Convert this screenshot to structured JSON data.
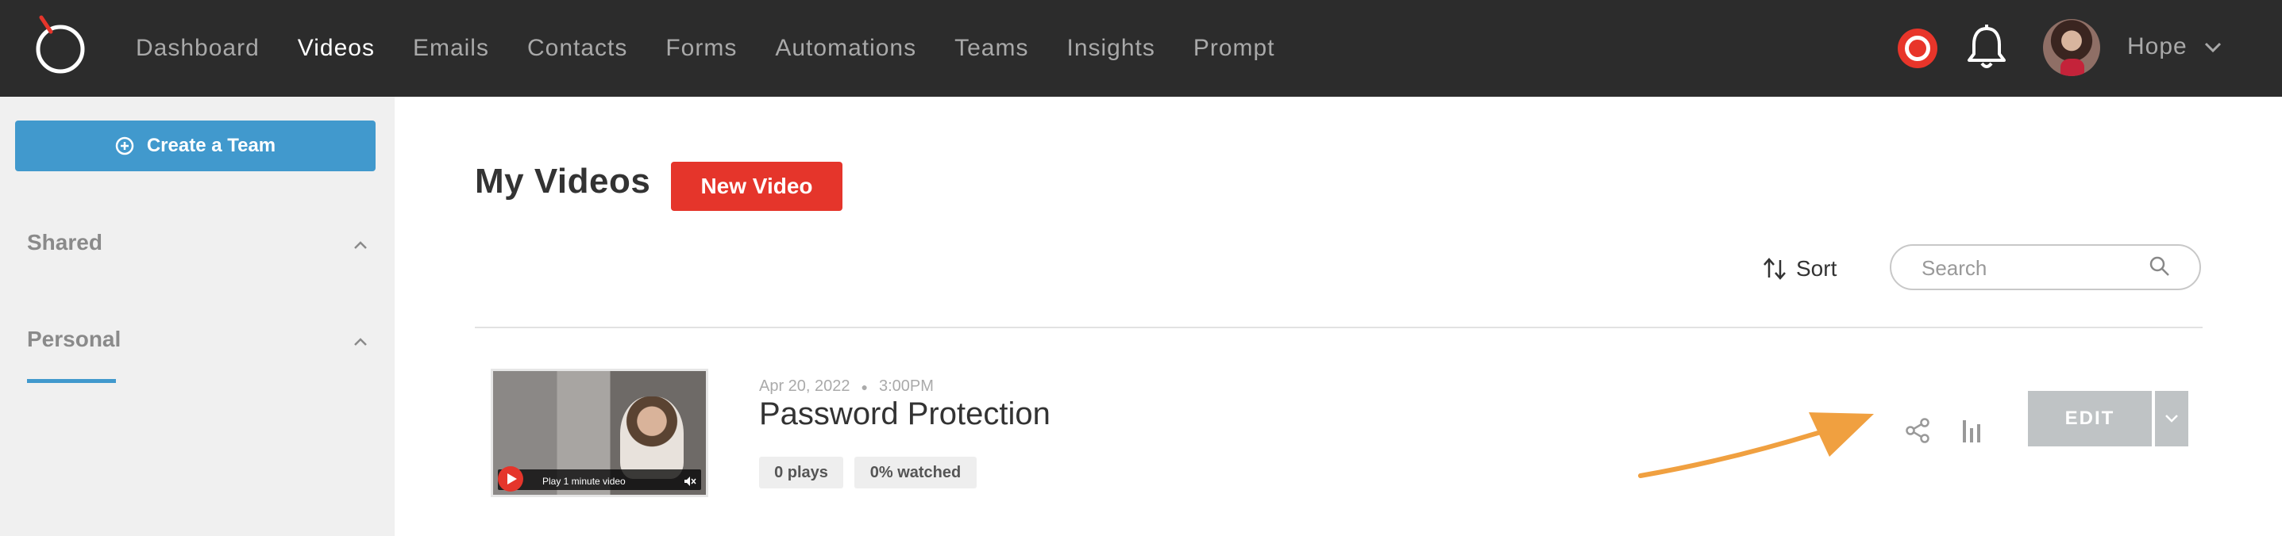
{
  "nav": {
    "items": [
      {
        "label": "Dashboard",
        "active": false
      },
      {
        "label": "Videos",
        "active": true
      },
      {
        "label": "Emails",
        "active": false
      },
      {
        "label": "Contacts",
        "active": false
      },
      {
        "label": "Forms",
        "active": false
      },
      {
        "label": "Automations",
        "active": false
      },
      {
        "label": "Teams",
        "active": false
      },
      {
        "label": "Insights",
        "active": false
      },
      {
        "label": "Prompt",
        "active": false
      }
    ],
    "user_name": "Hope"
  },
  "sidebar": {
    "create_team_label": "Create a Team",
    "sections": [
      {
        "label": "Shared"
      },
      {
        "label": "Personal"
      }
    ]
  },
  "main": {
    "title": "My Videos",
    "new_video_label": "New Video",
    "sort_label": "Sort",
    "search_placeholder": "Search",
    "videos": [
      {
        "date": "Apr 20, 2022",
        "time": "3:00PM",
        "title": "Password Protection",
        "plays": "0 plays",
        "watched": "0% watched",
        "thumb_play_label": "Play 1 minute video",
        "edit_label": "EDIT"
      }
    ]
  },
  "colors": {
    "topbar": "#2c2c2c",
    "accent_blue": "#4199cd",
    "accent_red": "#e5352b",
    "annotation_arrow": "#f0a040"
  }
}
